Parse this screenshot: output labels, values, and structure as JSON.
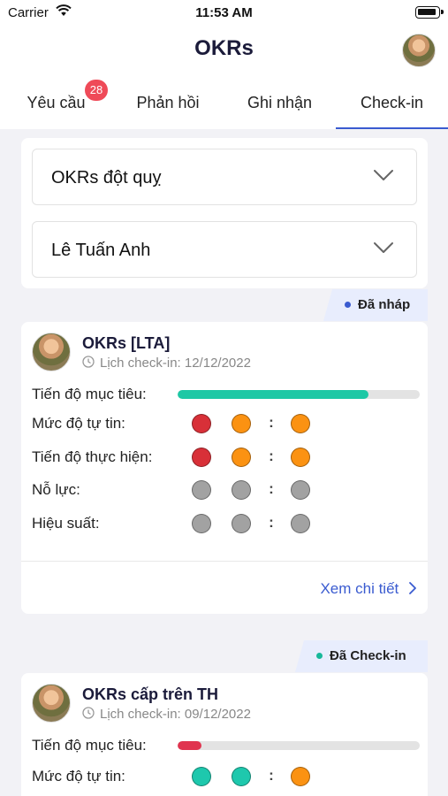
{
  "status_bar": {
    "carrier": "Carrier",
    "time": "11:53 AM"
  },
  "nav": {
    "title": "OKRs"
  },
  "tabs": [
    {
      "label": "Yêu cầu",
      "badge": "28"
    },
    {
      "label": "Phản hồi"
    },
    {
      "label": "Ghi nhận"
    },
    {
      "label": "Check-in",
      "active": true
    }
  ],
  "filters": {
    "okr_select": "OKRs đột quỵ",
    "person_select": "Lê Tuấn Anh"
  },
  "colors": {
    "accent": "#3a5bd0",
    "badge": "#ef4a58",
    "teal": "#1ec8a5",
    "red": "#e0344f",
    "dot_red": "#d83038",
    "dot_orange": "#fb9212",
    "dot_gray": "#a2a2a2",
    "dot_teal": "#1ec8ad"
  },
  "cards": [
    {
      "status": "Đã nháp",
      "status_dot": "#3a5bd0",
      "title": "OKRs [LTA]",
      "schedule": "Lịch check-in: 12/12/2022",
      "goal_progress_label": "Tiến độ mục tiêu:",
      "goal_progress": 0.79,
      "goal_color": "#1ec8a5",
      "rows": [
        {
          "label": "Mức độ tự tin:",
          "dots": [
            "red",
            "orange",
            "orange"
          ]
        },
        {
          "label": "Tiến độ thực hiện:",
          "dots": [
            "red",
            "orange",
            "orange"
          ]
        },
        {
          "label": "Nỗ lực:",
          "dots": [
            "gray",
            "gray",
            "gray"
          ]
        },
        {
          "label": "Hiệu suất:",
          "dots": [
            "gray",
            "gray",
            "gray"
          ]
        }
      ],
      "separator": ":",
      "detail_link": "Xem chi tiết"
    },
    {
      "status": "Đã Check-in",
      "status_dot": "#17b89a",
      "title": "OKRs cấp trên TH",
      "schedule": "Lịch check-in: 09/12/2022",
      "goal_progress_label": "Tiến độ mục tiêu:",
      "goal_progress": 0.1,
      "goal_color": "#e0344f",
      "rows": [
        {
          "label": "Mức độ tự tin:",
          "dots": [
            "teal",
            "teal",
            "orange"
          ]
        }
      ],
      "separator": ":"
    }
  ]
}
